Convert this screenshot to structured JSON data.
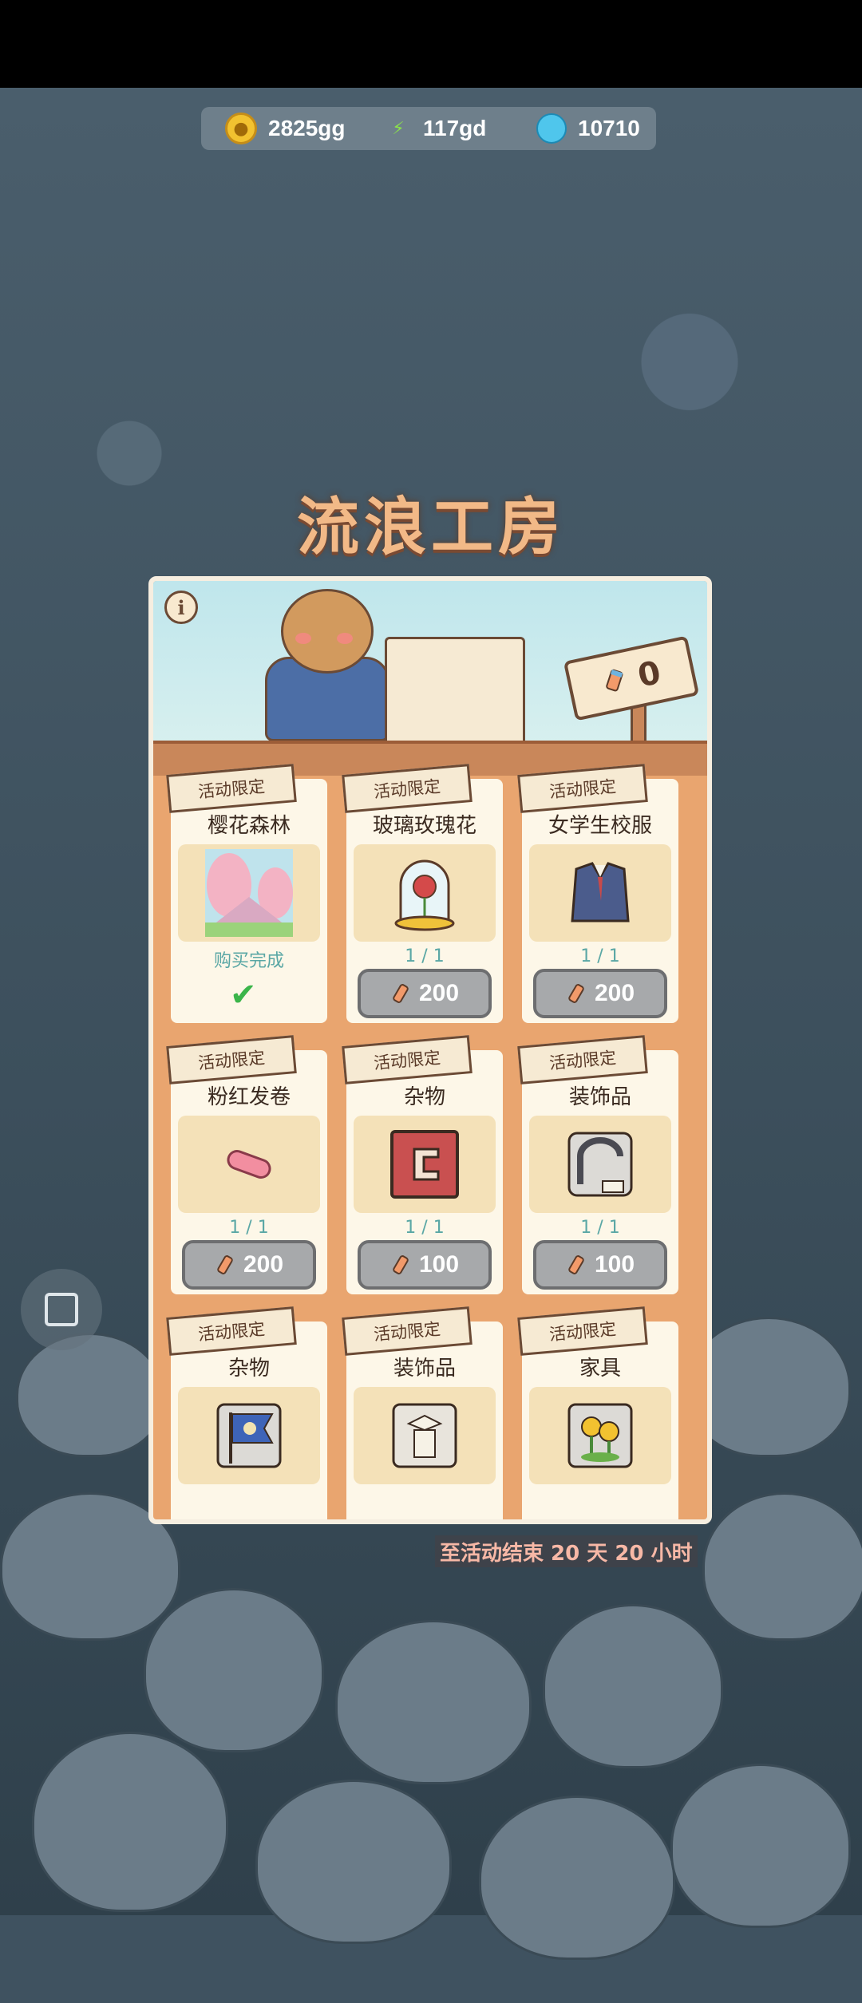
{
  "resources": {
    "coins": "2825gg",
    "energy": "117gd",
    "gems": "10710"
  },
  "title": "流浪工房",
  "panel": {
    "token_count": "0"
  },
  "items": [
    {
      "tag": "活动限定",
      "name": "樱花森林",
      "status": "购买完成",
      "purchased": true
    },
    {
      "tag": "活动限定",
      "name": "玻璃玫瑰花",
      "count": "1 / 1",
      "price": "200"
    },
    {
      "tag": "活动限定",
      "name": "女学生校服",
      "count": "1 / 1",
      "price": "200"
    },
    {
      "tag": "活动限定",
      "name": "粉红发卷",
      "count": "1 / 1",
      "price": "200"
    },
    {
      "tag": "活动限定",
      "name": "杂物",
      "count": "1 / 1",
      "price": "100"
    },
    {
      "tag": "活动限定",
      "name": "装饰品",
      "count": "1 / 1",
      "price": "100"
    },
    {
      "tag": "活动限定",
      "name": "杂物"
    },
    {
      "tag": "活动限定",
      "name": "装饰品"
    },
    {
      "tag": "活动限定",
      "name": "家具"
    }
  ],
  "timer": "至活动结束  20 天 20 小时",
  "colors": {
    "panel": "#e9a56f",
    "card": "#fdf7e8",
    "accent_teal": "#5aa7a5",
    "title": "#f2b987"
  }
}
